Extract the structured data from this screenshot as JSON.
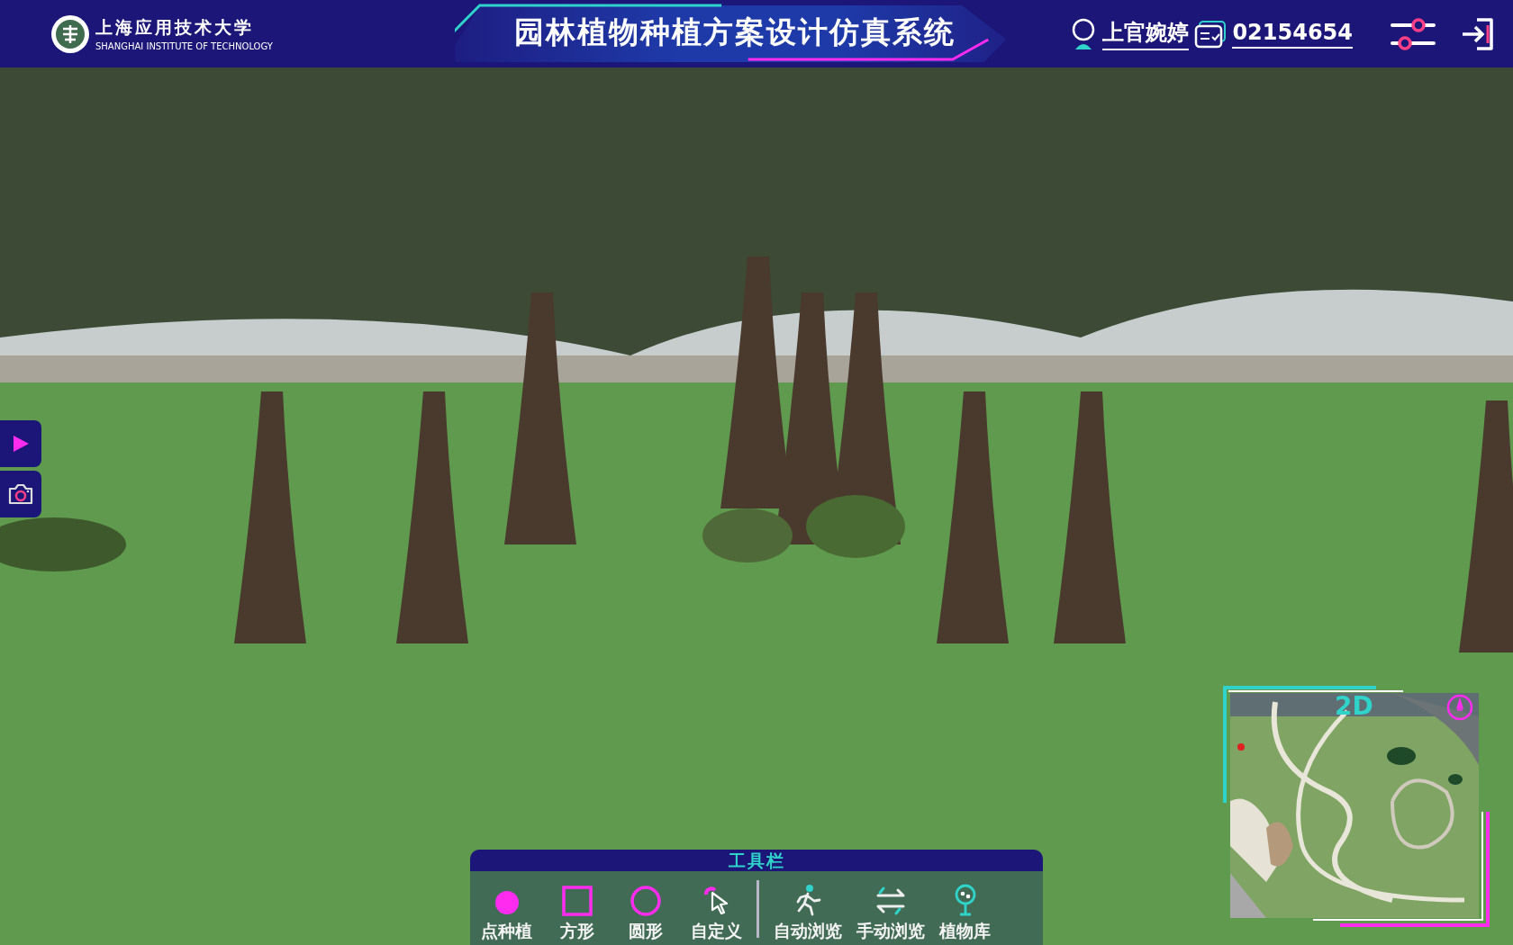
{
  "header": {
    "school_name": "上海应用技术大学",
    "school_name_en": "SHANGHAI INSTITUTE OF TECHNOLOGY",
    "title": "园林植物种植方案设计仿真系统",
    "user_name": "上官婉婷",
    "student_id": "02154654"
  },
  "side_buttons": [
    {
      "kind": "play"
    },
    {
      "kind": "camera"
    }
  ],
  "toolbar": {
    "title": "工具栏",
    "groups": [
      [
        {
          "kind": "dot",
          "label": "点种植"
        },
        {
          "kind": "square",
          "label": "方形"
        },
        {
          "kind": "circle",
          "label": "圆形"
        },
        {
          "kind": "cursor",
          "label": "自定义"
        }
      ],
      [
        {
          "kind": "walk",
          "label": "自动浏览"
        },
        {
          "kind": "swap",
          "label": "手动浏览"
        },
        {
          "kind": "tree",
          "label": "植物库"
        }
      ]
    ]
  },
  "minimap": {
    "mode": "2D"
  }
}
